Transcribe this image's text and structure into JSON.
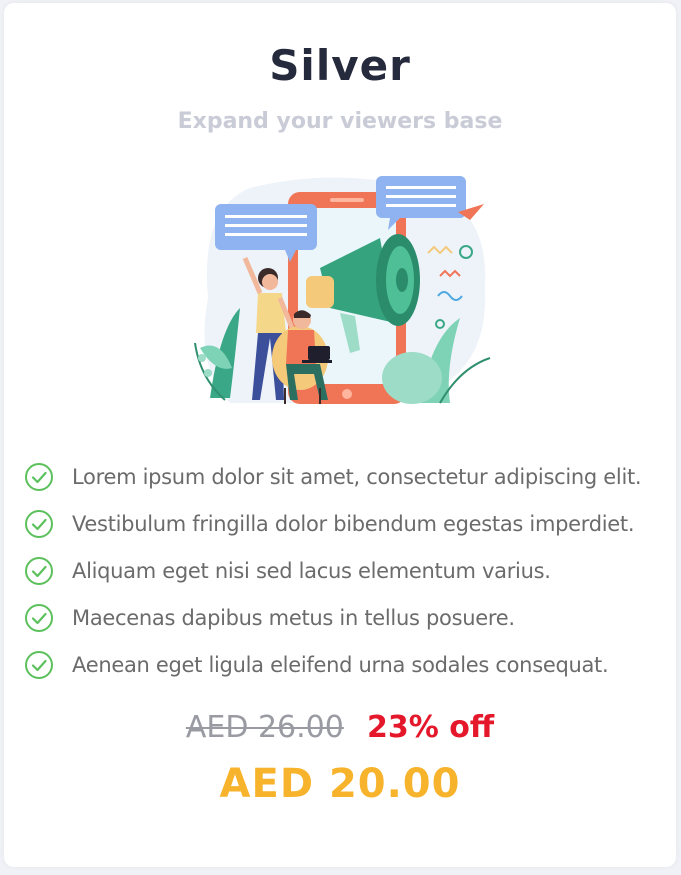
{
  "plan": {
    "title": "Silver",
    "subtitle": "Expand your viewers base"
  },
  "illustration": {
    "icon": "megaphone-marketing-illustration"
  },
  "features": [
    {
      "icon": "check-circle-icon",
      "text": "Lorem ipsum dolor sit amet, consectetur adipiscing elit."
    },
    {
      "icon": "check-circle-icon",
      "text": "Vestibulum fringilla dolor bibendum egestas imperdiet."
    },
    {
      "icon": "check-circle-icon",
      "text": "Aliquam eget nisi sed lacus elementum varius."
    },
    {
      "icon": "check-circle-icon",
      "text": "Maecenas dapibus metus in tellus posuere."
    },
    {
      "icon": "check-circle-icon",
      "text": "Aenean eget ligula eleifend urna sodales consequat."
    }
  ],
  "pricing": {
    "original_price": "AED 26.00",
    "discount": "23% off",
    "current_price": "AED 20.00"
  },
  "colors": {
    "title": "#262a3d",
    "subtitle": "#c9cbd6",
    "check": "#5cc15c",
    "discount": "#e4182a",
    "current_price": "#f7b32b",
    "original_price": "#9a9aa3"
  }
}
